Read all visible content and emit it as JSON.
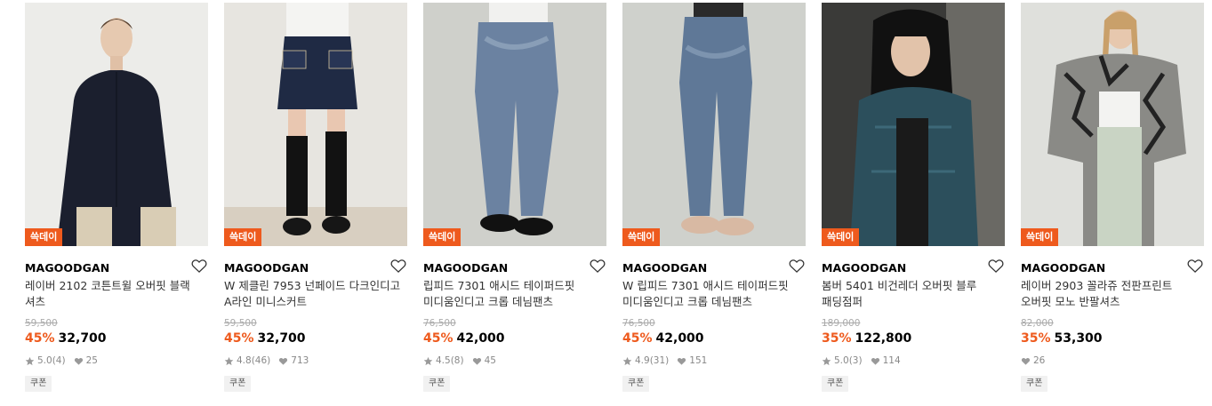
{
  "products": [
    {
      "badge": "쓱데이",
      "brand": "MAGOODGAN",
      "title": "레이버 2102 코튼트윌 오버핏 블랙 셔츠",
      "original_price": "59,500",
      "discount": "45%",
      "price": "32,700",
      "rating": "5.0",
      "review_count": "(4)",
      "likes": "25",
      "coupon": "쿠폰"
    },
    {
      "badge": "쓱데이",
      "brand": "MAGOODGAN",
      "title": "W 제클린 7953 넌페이드 다크인디고 A라인 미니스커트",
      "original_price": "59,500",
      "discount": "45%",
      "price": "32,700",
      "rating": "4.8",
      "review_count": "(46)",
      "likes": "713",
      "coupon": "쿠폰"
    },
    {
      "badge": "쓱데이",
      "brand": "MAGOODGAN",
      "title": "립피드 7301 애시드 테이퍼드핏 미디움인디고 크롭 데님팬츠",
      "original_price": "76,500",
      "discount": "45%",
      "price": "42,000",
      "rating": "4.5",
      "review_count": "(8)",
      "likes": "45",
      "coupon": "쿠폰"
    },
    {
      "badge": "쓱데이",
      "brand": "MAGOODGAN",
      "title": "W 립피드 7301 애시드 테이퍼드핏 미디움인디고 크롭 데님팬츠",
      "original_price": "76,500",
      "discount": "45%",
      "price": "42,000",
      "rating": "4.9",
      "review_count": "(31)",
      "likes": "151",
      "coupon": "쿠폰"
    },
    {
      "badge": "쓱데이",
      "brand": "MAGOODGAN",
      "title": "봄버 5401 비건레더 오버핏 블루 패딩점퍼",
      "original_price": "189,000",
      "discount": "35%",
      "price": "122,800",
      "rating": "5.0",
      "review_count": "(3)",
      "likes": "114",
      "coupon": "쿠폰"
    },
    {
      "badge": "쓱데이",
      "brand": "MAGOODGAN",
      "title": "레이버 2903 꼴라쥬 전판프린트 오버핏 모노 반팔셔츠",
      "original_price": "82,000",
      "discount": "35%",
      "price": "53,300",
      "rating": "",
      "review_count": "",
      "likes": "26",
      "coupon": "쿠폰"
    }
  ],
  "colors": {
    "accent": "#ee5a1d",
    "muted": "#aaaaaa",
    "coupon_bg": "#f1f1f1"
  }
}
